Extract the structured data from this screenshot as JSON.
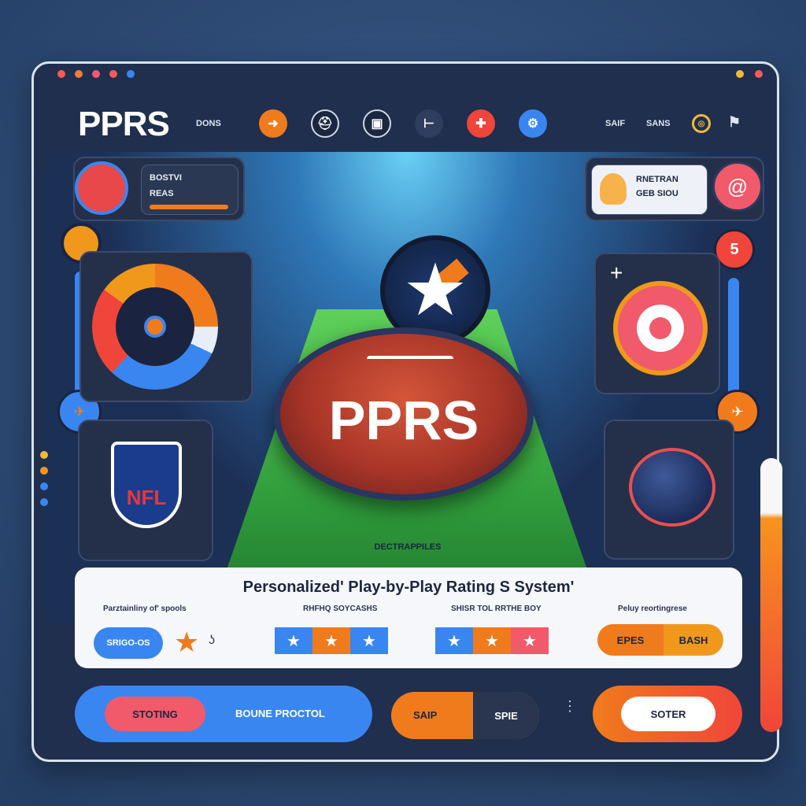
{
  "window": {
    "traffic_lights": [
      "#f25a5a",
      "#f07b3a",
      "#f0b93a",
      "#3a86f0"
    ],
    "corner_lights": [
      "#f0b93a",
      "#f25a5a"
    ]
  },
  "header": {
    "logo": "PPRS",
    "nav_left": "DONS",
    "nav_right_1": "SAIF",
    "nav_right_2": "SANS",
    "nav_icons": [
      "arrow-icon",
      "helmet-icon",
      "screen-icon",
      "network-icon",
      "medical-icon",
      "share-icon"
    ],
    "target_icon": "target-icon",
    "flag_icon": "flag-icon"
  },
  "left_top_card": {
    "line1": "BOSTVI",
    "line2": "REAS"
  },
  "right_top_card": {
    "line1": "RNETRAN",
    "line2": "GEB SIOU"
  },
  "center": {
    "ball_text": "PPRS",
    "ribbon_caption": "DECTRAPPILES"
  },
  "side_badges": {
    "right_number": "5"
  },
  "nfl_badge": {
    "text": "NFL"
  },
  "info_card": {
    "title": "Personalized' Play-by-Play Rating S System'",
    "columns": [
      {
        "label": "Parztainliny of' spools"
      },
      {
        "label": "RHFHQ SOYCASHS"
      },
      {
        "label": "SHISR TOL RRTHE BOY"
      },
      {
        "label": "Peluy reortingrese"
      }
    ],
    "left_pill": "SRIGO-OS",
    "ratings_a": [
      "★",
      "★",
      "★"
    ],
    "ratings_b": [
      "★",
      "★",
      "★"
    ],
    "button_epes": "EPES",
    "button_bash": "BASH"
  },
  "bottom_bar": {
    "stoting": "STOTING",
    "boune_proctol": "BOUNE PROCTOL",
    "saip": "SAIP",
    "spie": "SPIE",
    "soter": "SOTER"
  }
}
